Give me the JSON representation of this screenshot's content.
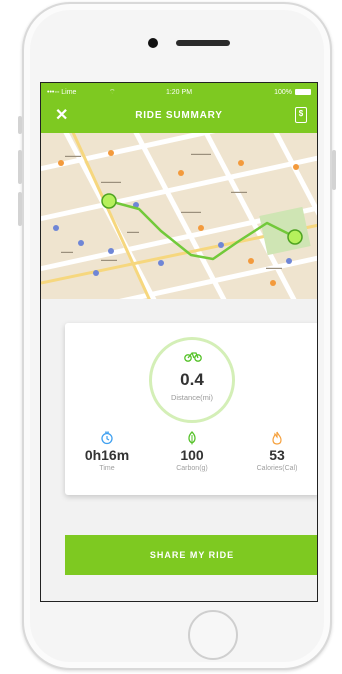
{
  "status_bar": {
    "carrier": "•••◦◦ Lime",
    "time": "1:20 PM",
    "battery": "100%"
  },
  "header": {
    "close_icon": "close-icon",
    "title": "RIDE SUMMARY",
    "receipt_icon": "receipt-icon",
    "receipt_symbol": "$"
  },
  "summary": {
    "distance": {
      "value": "0.4",
      "label": "Distance(mi)",
      "icon": "bike-icon"
    },
    "stats": [
      {
        "icon": "clock-icon",
        "value": "0h16m",
        "label": "Time",
        "color": "#3fa0f0"
      },
      {
        "icon": "leaf-icon",
        "value": "100",
        "label": "Carbon(g)",
        "color": "#56c22a"
      },
      {
        "icon": "flame-icon",
        "value": "53",
        "label": "Calories(Cal)",
        "color": "#f5a03c"
      }
    ]
  },
  "share_button": {
    "label": "SHARE MY RIDE"
  },
  "colors": {
    "brand_green": "#7ec921",
    "route_green": "#72c93a"
  }
}
